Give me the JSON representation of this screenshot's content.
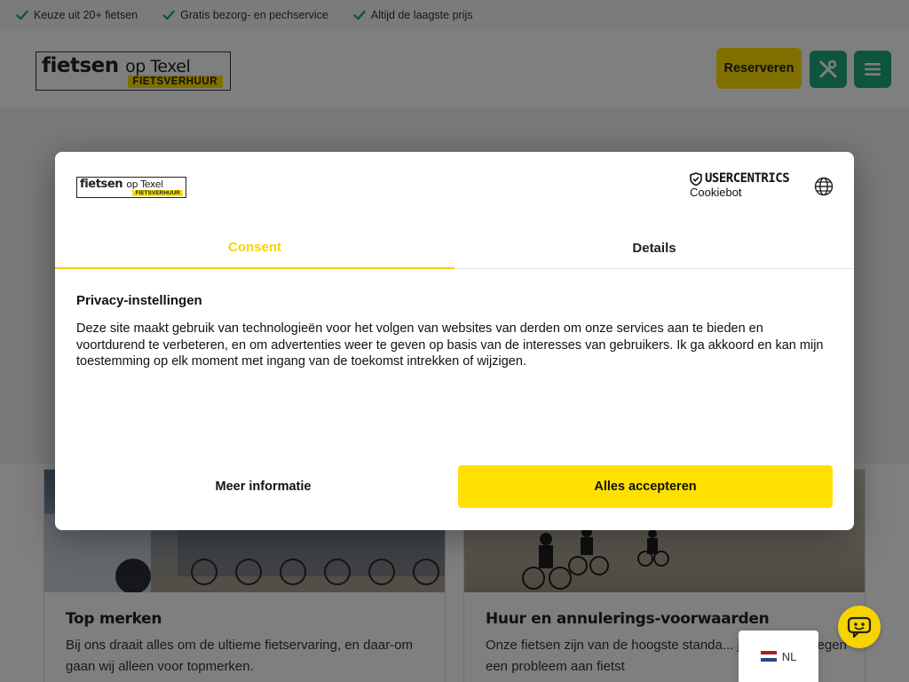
{
  "usp": [
    {
      "label": "Keuze uit 20+ fietsen",
      "icon": "check-icon"
    },
    {
      "label": "Gratis bezorg- en pechservice",
      "icon": "check-icon"
    },
    {
      "label": "Altijd de laagste prijs",
      "icon": "check-icon"
    }
  ],
  "header": {
    "logo_word": "fietsen",
    "logo_op": "op Texel",
    "logo_sub": "FIETSVERHUUR",
    "reserve_label": "Reserveren",
    "tools_icon": "tools-icon",
    "menu_icon": "hamburger-menu-icon"
  },
  "cards": [
    {
      "title": "Top merken",
      "text": "Bij ons draait alles om de ultieme fietservaring, en daar-om gaan wij alleen voor topmerken."
    },
    {
      "title": "Huur en annulerings-voorwaarden",
      "text": "Onze fietsen zijn van de hoogste standa... je onderweg tegen een probleem aan fietst"
    }
  ],
  "consent": {
    "provider_top": "USERCENTRICS",
    "provider_bottom": "Cookiebot",
    "tabs": [
      "Consent",
      "Details"
    ],
    "heading": "Privacy-instellingen",
    "body": "Deze site maakt gebruik van technologieën voor het volgen van websites van derden om onze services aan te bieden en voortdurend te verbeteren, en om advertenties weer te geven op basis van de interesses van gebruikers. Ik ga akkoord en kan mijn toestemming op elk moment met ingang van de toekomst intrekken of wijzigen.",
    "more_label": "Meer informatie",
    "accept_label": "Alles accepteren"
  },
  "language": {
    "code": "NL",
    "icon": "dutch-flag-icon"
  },
  "colors": {
    "accent_yellow": "#ffe000",
    "accent_green": "#1fa87d",
    "check_green": "#1fa87d"
  }
}
